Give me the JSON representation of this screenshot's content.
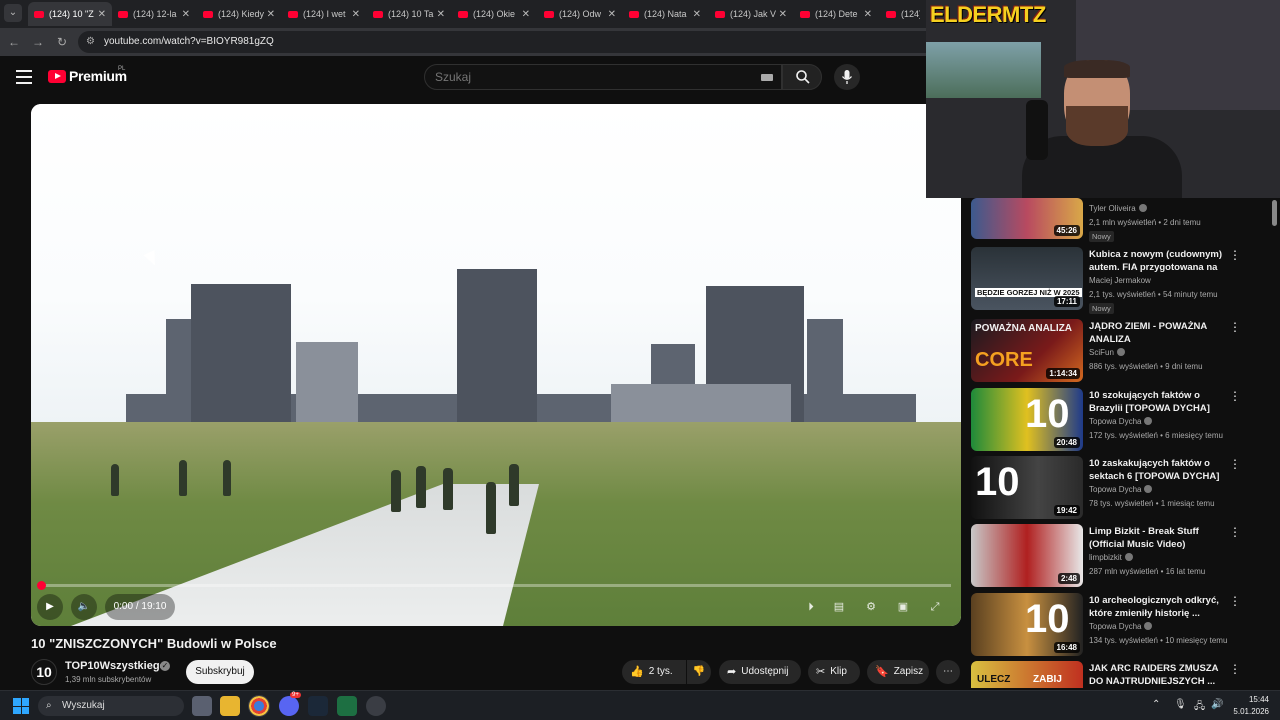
{
  "browser": {
    "tabs": [
      {
        "label": "(124) 10 \"Z",
        "active": true
      },
      {
        "label": "(124) 12-la"
      },
      {
        "label": "(124) Kiedy"
      },
      {
        "label": "(124) I wet"
      },
      {
        "label": "(124) 10 Ta"
      },
      {
        "label": "(124) Okie"
      },
      {
        "label": "(124) Odw"
      },
      {
        "label": "(124) Nata"
      },
      {
        "label": "(124) Jak V"
      },
      {
        "label": "(124) Dete"
      },
      {
        "label": "(124) M"
      }
    ],
    "url": "youtube.com/watch?v=BIOYR981gZQ"
  },
  "masthead": {
    "logo_text": "Premium",
    "logo_country": "PL",
    "search_placeholder": "Szukaj"
  },
  "player": {
    "time": "0:00 / 19:10",
    "progress": 0.0
  },
  "video": {
    "title": "10 \"ZNISZCZONYCH\" Budowli w Polsce",
    "channel": "TOP10Wszystkiego",
    "avatar_text": "10",
    "subscribers": "1,39 mln subskrybentów",
    "subscribe_label": "Subskrybuj",
    "likes": "2 tys.",
    "share_label": "Udostępnij",
    "clip_label": "Klip",
    "save_label": "Zapisz"
  },
  "webcam": {
    "logo_text": "ELDERMTZ"
  },
  "recommendations": [
    {
      "title": "",
      "channel": "Tyler Oliveira",
      "meta": "2,1 mln wyświetleń • 2 dni temu",
      "badge": "Nowy",
      "duration": "45:26"
    },
    {
      "title": "Kubica z nowym (cudownym) autem. FIA przygotowana na ...",
      "channel": "Maciej Jermakow",
      "meta": "2,1 tys. wyświetleń • 54 minuty temu",
      "badge": "Nowy",
      "duration": "17:11",
      "thumb_text": "BĘDZIE GORZEJ NIŻ W 2025"
    },
    {
      "title": "JĄDRO ZIEMI - POWAŻNA ANALIZA",
      "channel": "SciFun",
      "meta": "886 tys. wyświetleń • 9 dni temu",
      "duration": "1:14:34",
      "thumb_text": "POWAŻNA ANALIZA",
      "thumb_text2": "CORE"
    },
    {
      "title": "10 szokujących faktów o Brazylii [TOPOWA DYCHA]",
      "channel": "Topowa Dycha",
      "meta": "172 tys. wyświetleń • 6 miesięcy temu",
      "duration": "20:48",
      "thumb_text": "10"
    },
    {
      "title": "10 zaskakujących faktów o sektach 6 [TOPOWA DYCHA]",
      "channel": "Topowa Dycha",
      "meta": "78 tys. wyświetleń • 1 miesiąc temu",
      "duration": "19:42",
      "thumb_text": "10"
    },
    {
      "title": "Limp Bizkit - Break Stuff (Official Music Video)",
      "channel": "limpbizkit",
      "meta": "287 mln wyświetleń • 16 lat temu",
      "duration": "2:48"
    },
    {
      "title": "10 archeologicznych odkryć, które zmieniły historię ...",
      "channel": "Topowa Dycha",
      "meta": "134 tys. wyświetleń • 10 miesięcy temu",
      "duration": "16:48",
      "thumb_text": "10"
    },
    {
      "title": "JAK ARC RAIDERS ZMUSZA DO NAJTRUDNIEJSZYCH ...",
      "channel": "",
      "meta": "",
      "duration": "",
      "thumb_text": "ULECZ",
      "thumb_text2": "ZABIJ"
    }
  ],
  "taskbar": {
    "search_label": "Wyszukaj",
    "time": "15:44",
    "date": "5.01.2026",
    "discord_badge": "9+"
  }
}
